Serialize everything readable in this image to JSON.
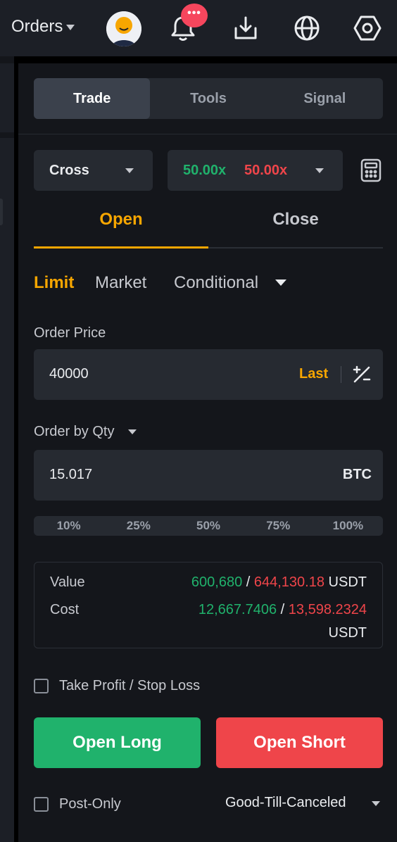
{
  "header": {
    "orders_label": "Orders",
    "badge_text": "•••",
    "icons": [
      "avatar",
      "bell-icon",
      "download-icon",
      "globe-icon",
      "settings-icon"
    ]
  },
  "tabs": [
    {
      "label": "Trade",
      "active": true
    },
    {
      "label": "Tools",
      "active": false
    },
    {
      "label": "Signal",
      "active": false
    }
  ],
  "margin_mode": "Cross",
  "leverage": {
    "long": "50.00x",
    "short": "50.00x"
  },
  "open_close": {
    "open": "Open",
    "close": "Close",
    "active": "Open"
  },
  "order_types": {
    "limit": "Limit",
    "market": "Market",
    "conditional": "Conditional",
    "active": "Limit"
  },
  "order_price": {
    "label": "Order Price",
    "value": "40000",
    "last_label": "Last"
  },
  "order_qty": {
    "label": "Order by Qty",
    "value": "15.017",
    "unit": "BTC"
  },
  "percentages": [
    "10%",
    "25%",
    "50%",
    "75%",
    "100%"
  ],
  "summary": {
    "value_label": "Value",
    "value_long": "600,680",
    "value_short": "644,130.18",
    "value_unit": "USDT",
    "cost_label": "Cost",
    "cost_long": "12,667.7406",
    "cost_short": "13,598.2324",
    "cost_unit": "USDT",
    "separator": "/"
  },
  "tpsl_label": "Take Profit / Stop Loss",
  "buttons": {
    "long": "Open Long",
    "short": "Open Short"
  },
  "post_only_label": "Post-Only",
  "time_in_force": "Good-Till-Canceled",
  "colors": {
    "accent": "#f7a600",
    "long": "#20b26c",
    "short": "#ef454a",
    "bg": "#14161b",
    "field": "#262a31"
  }
}
